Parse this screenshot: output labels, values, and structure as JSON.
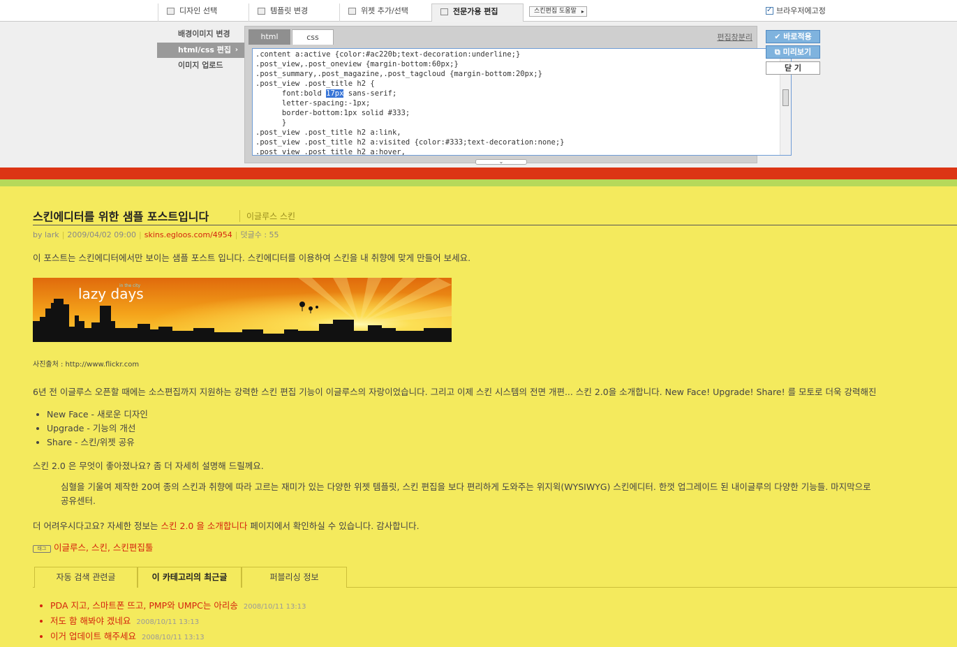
{
  "toolbar": {
    "tabs": [
      {
        "label": "디자인 선택",
        "icon": "layout-icon"
      },
      {
        "label": "템플릿 변경",
        "icon": "template-icon"
      },
      {
        "label": "위젯 추가/선택",
        "icon": "widget-icon"
      },
      {
        "label": "전문가용 편집",
        "icon": "edit-icon"
      }
    ],
    "help_label": "스킨편집 도움말",
    "fix_label": "브라우저에고정",
    "fix_checked": true
  },
  "editor": {
    "nav": [
      {
        "label": "배경이미지 변경"
      },
      {
        "label": "html/css 편집"
      },
      {
        "label": "이미지 업로드"
      }
    ],
    "code_tabs": [
      {
        "label": "html"
      },
      {
        "label": "css"
      }
    ],
    "active_code_tab": "css",
    "split_label": "편집창분리",
    "code_lines": [
      ".content a:active {color:#ac220b;text-decoration:underline;}",
      ".post_view,.post_oneview {margin-bottom:60px;}",
      ".post_summary,.post_magazine,.post_tagcloud {margin-bottom:20px;}",
      ".post_view .post_title h2 {",
      "      font:bold 17px sans-serif;",
      "      letter-spacing:-1px;",
      "      border-bottom:1px solid #333;",
      "      }",
      ".post_view .post_title h2 a:link,",
      ".post_view .post_title h2 a:visited {color:#333;text-decoration:none;}",
      ".post_view .post_title h2 a:hover,"
    ],
    "selected_text": "17px",
    "buttons": {
      "apply": "바로적용",
      "preview": "미리보기",
      "close": "닫 기"
    }
  },
  "post": {
    "title": "스킨에디터를 위한 샘플 포스트입니다",
    "category": "이글루스 스킨",
    "meta": {
      "by": "by lark",
      "date": "2009/04/02 09:00",
      "link": "skins.egloos.com/4954",
      "comments": "덧글수 : 55"
    },
    "intro": "이 포스트는 스킨에디터에서만 보이는 샘플 포스트 입니다. 스킨에디터를 이용하여 스킨을 내 취향에 맞게 만들어 보세요.",
    "banner": {
      "text": "lazy days",
      "subtext": "in the city"
    },
    "photo_credit": "사진출처 : http://www.flickr.com",
    "para1": "6년 전 이글루스 오픈할 때에는 소스편집까지 지원하는 강력한 스킨 편집 기능이 이글루스의 자랑이었습니다. 그리고 이제 스킨 시스템의 전면 개편... 스킨 2.0을 소개합니다. New Face! Upgrade! Share! 를 모토로 더욱 강력해진",
    "features": [
      "New Face - 새로운 디자인",
      "Upgrade - 기능의 개선",
      "Share - 스킨/위젯 공유"
    ],
    "para2": "스킨 2.0 은 무엇이 좋아졌나요? 좀 더 자세히 설명해 드릴께요.",
    "quote_line1": "심혈을 기울여 제작한 20여 종의 스킨과 취향에 따라 고르는 재미가 있는 다양한 위젯 템플릿, 스킨 편집을 보다 편리하게 도와주는 위지윅(WYSIWYG) 스킨에디터. 한껏 업그레이드 된 내이글루의 다양한 기능들. 마지막으로",
    "quote_line2": "공유센터.",
    "more_prefix": "더 어려우시다고요? 자세한 정보는 ",
    "more_link": "스킨 2.0 을 소개합니다",
    "more_suffix": " 페이지에서 확인하실 수 있습니다. 감사합니다.",
    "tag_icon": "태그",
    "tags": "이글루스, 스킨, 스킨편집툴",
    "related_tabs": [
      "자동 검색 관련글",
      "이 카테고리의 최근글",
      "퍼블리싱 정보"
    ],
    "recent": [
      {
        "title": "PDA 지고, 스마트폰 뜨고, PMP와 UMPC는 아리송",
        "date": "2008/10/11 13:13"
      },
      {
        "title": "저도 함 해봐야 겠네요",
        "date": "2008/10/11 13:13"
      },
      {
        "title": "이거 업데이트 해주세요",
        "date": "2008/10/11 13:13"
      }
    ]
  },
  "colors": {
    "background": "#f4ea5d",
    "stripe_red": "#dc3514",
    "stripe_green": "#b6d95a",
    "link": "#d4230d",
    "accent_button": "#7fb3de"
  }
}
